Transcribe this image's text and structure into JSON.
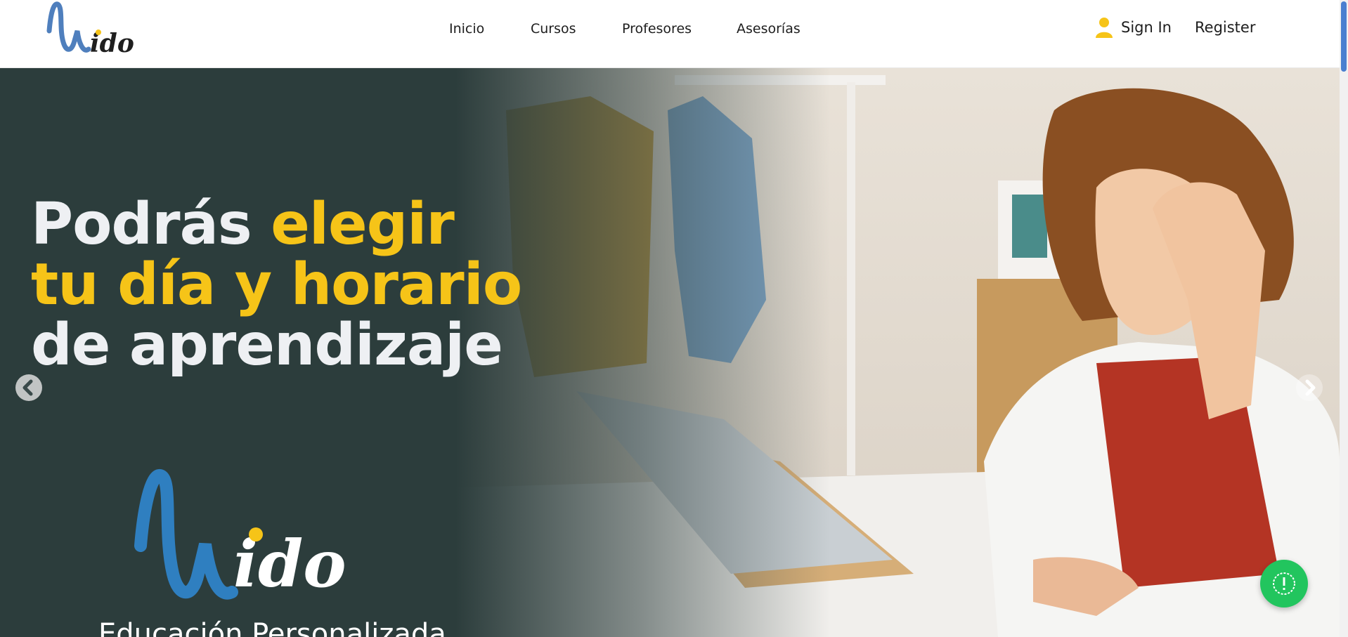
{
  "header": {
    "brand": "Wido",
    "nav": [
      {
        "label": "Inicio"
      },
      {
        "label": "Cursos"
      },
      {
        "label": "Profesores"
      },
      {
        "label": "Asesorías"
      }
    ],
    "sign_in": "Sign In",
    "register": "Register"
  },
  "hero": {
    "headline": {
      "l1_white": "Podrás ",
      "l1_yellow": "elegir",
      "l2_yellow": "tu día y horario",
      "l3_white": "de aprendizaje"
    },
    "brand_logo": "Wido",
    "tagline": "Educación Personalizada"
  },
  "icons": {
    "user": "user-icon",
    "prev": "chevron-left-icon",
    "next": "chevron-right-icon",
    "help": "alert-circle-icon"
  },
  "colors": {
    "accent_yellow": "#f6c418",
    "brand_blue": "#2f7fc0",
    "dark_panel": "#2c3d3c",
    "help_green": "#22c55e"
  }
}
